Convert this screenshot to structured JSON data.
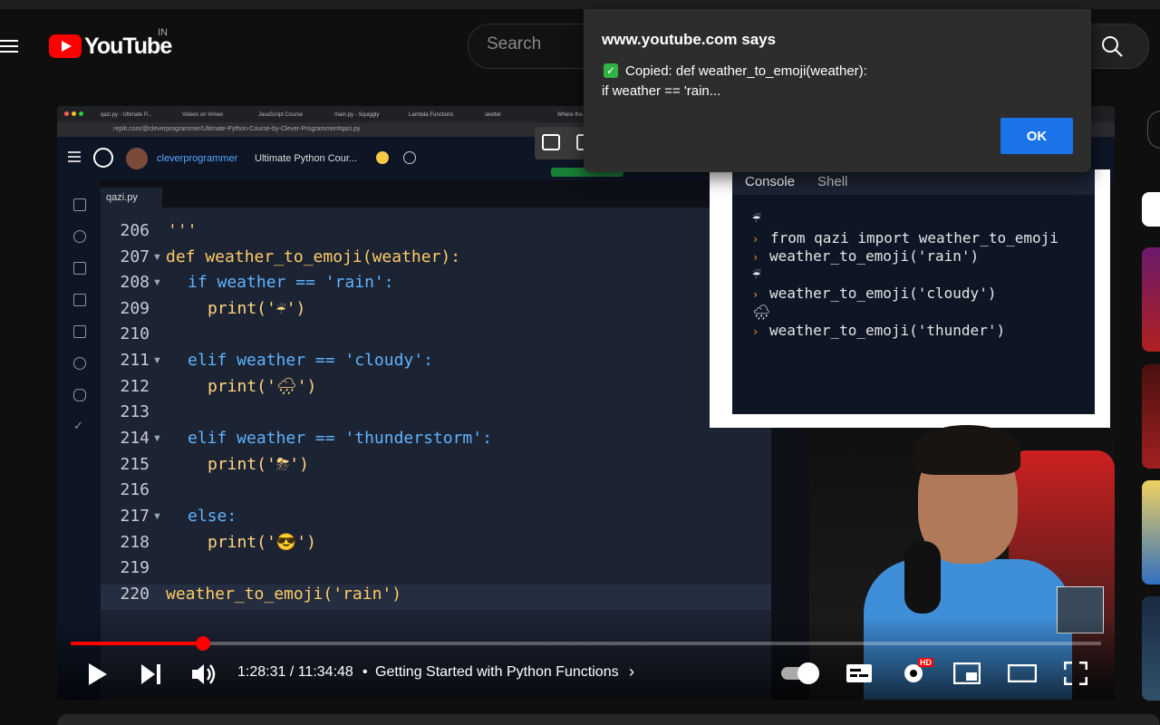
{
  "header": {
    "logo_text": "YouTube",
    "country": "IN",
    "search_placeholder": "Search"
  },
  "video": {
    "browser_url": "replit.com/@cleverprogrammer/Ultimate-Python-Course-by-Clever-Programmer#qazi.py",
    "browser_tabs": [
      "qazi.py - Ultimate P...",
      "Videos on Vimeo",
      "JavaScript Course",
      "main.py - Squiggly",
      "Lambda Functions",
      "sketter",
      "Where the..."
    ],
    "replit_user": "cleverprogrammer",
    "replit_project": "Ultimate Python Cour...",
    "file_tab": "qazi.py",
    "code_lines": [
      {
        "n": "206",
        "text": "'''"
      },
      {
        "n": "207",
        "text": "def weather_to_emoji(weather):"
      },
      {
        "n": "208",
        "text": "if weather == 'rain':"
      },
      {
        "n": "209",
        "text": "print('☔')"
      },
      {
        "n": "210",
        "text": ""
      },
      {
        "n": "211",
        "text": "elif weather == 'cloudy':"
      },
      {
        "n": "212",
        "text": "print('🌧')"
      },
      {
        "n": "213",
        "text": ""
      },
      {
        "n": "214",
        "text": "elif weather == 'thunderstorm':"
      },
      {
        "n": "215",
        "text": "print('⛈')"
      },
      {
        "n": "216",
        "text": ""
      },
      {
        "n": "217",
        "text": "else:"
      },
      {
        "n": "218",
        "text": "print('😎')"
      },
      {
        "n": "219",
        "text": ""
      },
      {
        "n": "220",
        "text": "weather_to_emoji('rain')"
      }
    ],
    "console_tabs": [
      "Console",
      "Shell"
    ],
    "console_lines": [
      "☔",
      "from qazi import weather_to_emoji",
      "weather_to_emoji('rain')",
      "☔",
      "weather_to_emoji('cloudy')",
      "🌧",
      "weather_to_emoji('thunder')"
    ]
  },
  "player": {
    "time": "1:28:31 / 11:34:48",
    "chapter": "Getting Started with Python Functions",
    "quality_badge": "HD",
    "progress": 0.128
  },
  "dialog": {
    "title": "www.youtube.com says",
    "message_line1": "Copied: def weather_to_emoji(weather):",
    "message_line2": "if weather == 'rain...",
    "ok_label": "OK"
  },
  "colors": {
    "accent_red": "#ff0000",
    "ok_blue": "#1a73e8",
    "dialog_bg": "#2d2d2d"
  }
}
